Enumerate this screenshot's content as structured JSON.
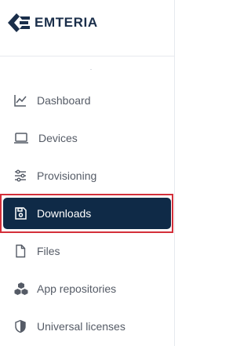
{
  "brand": {
    "name": "EMTERIA",
    "icon": "emteria-logo-icon",
    "color": "#1a2e4a"
  },
  "nav": {
    "items": [
      {
        "label": "Dashboard",
        "icon": "chart-line-icon",
        "active": false
      },
      {
        "label": "Devices",
        "icon": "laptop-icon",
        "active": false
      },
      {
        "label": "Provisioning",
        "icon": "sliders-icon",
        "active": false
      },
      {
        "label": "Downloads",
        "icon": "floppy-disk-icon",
        "active": true
      },
      {
        "label": "Files",
        "icon": "file-icon",
        "active": false
      },
      {
        "label": "App repositories",
        "icon": "cubes-icon",
        "active": false
      },
      {
        "label": "Universal licenses",
        "icon": "shield-icon",
        "active": false
      }
    ]
  },
  "colors": {
    "active_bg": "#0f2a47",
    "highlight": "#d32f3a",
    "text": "#555b66"
  }
}
